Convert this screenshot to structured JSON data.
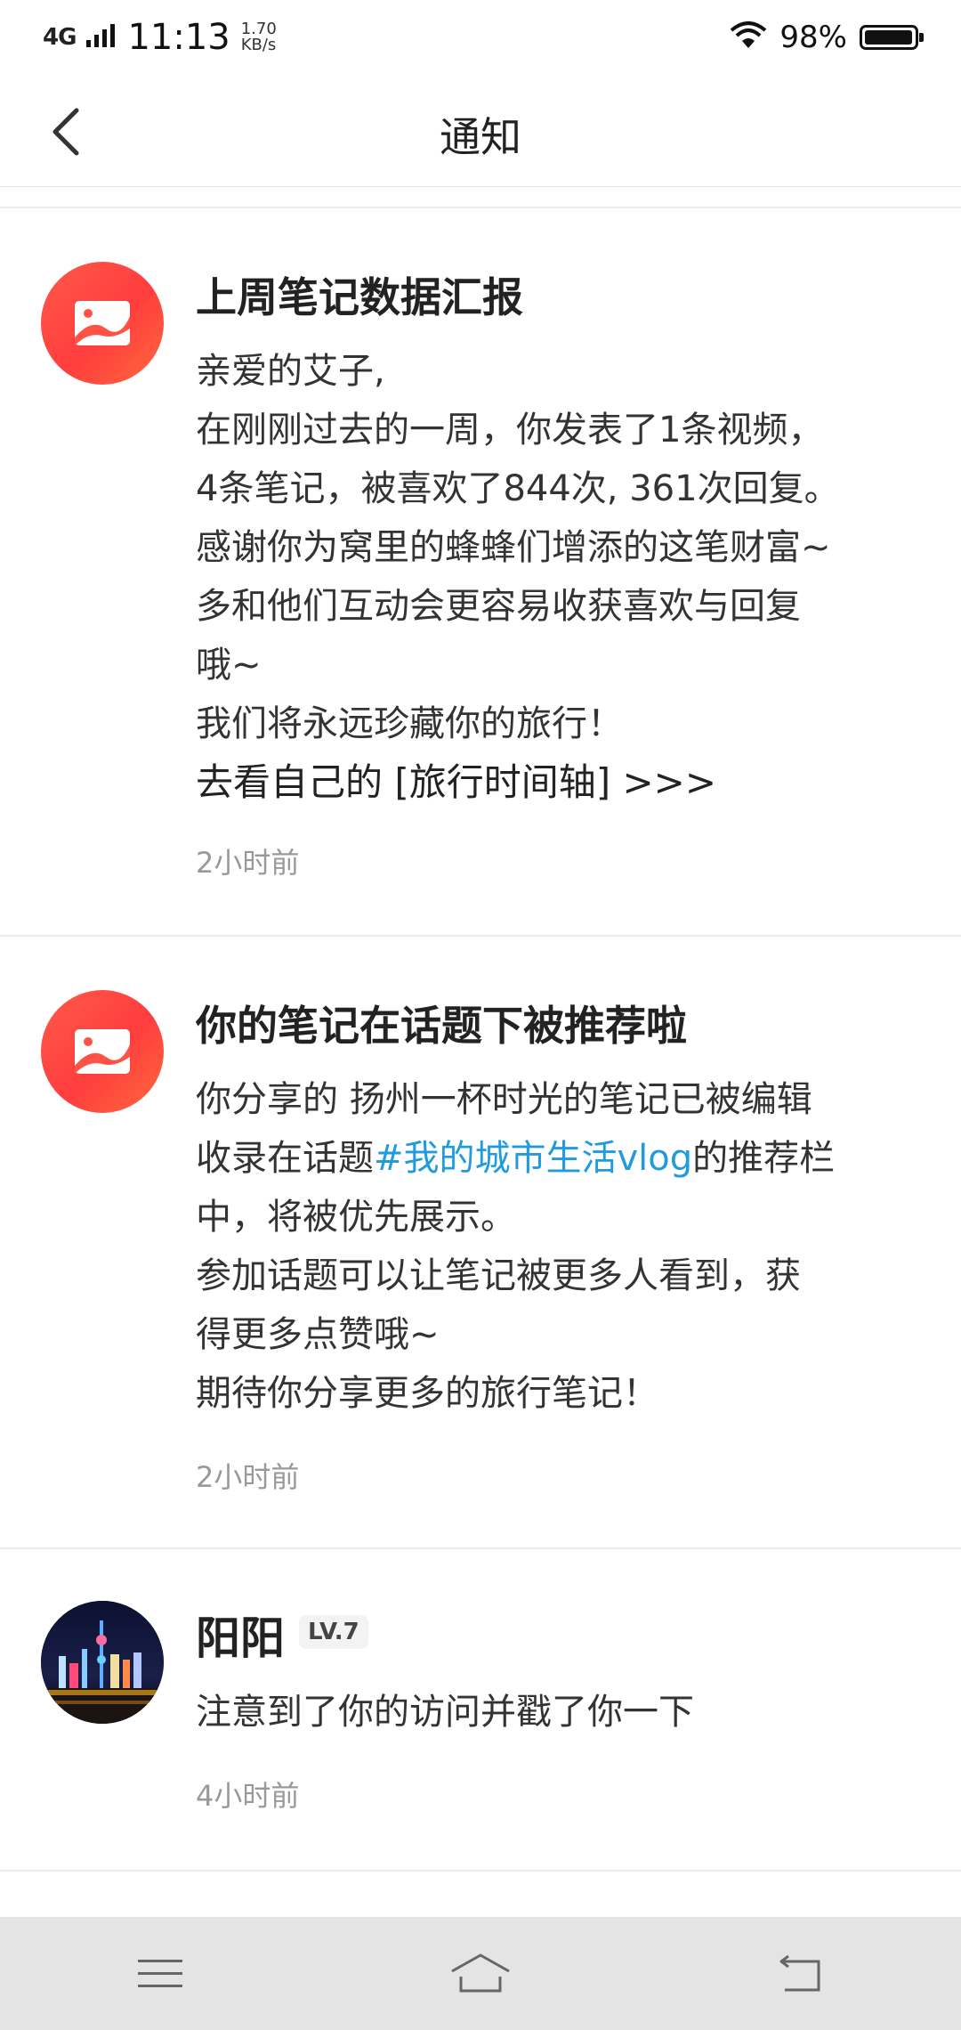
{
  "status_bar": {
    "network": "4G",
    "time": "11:13",
    "speed_value": "1.70",
    "speed_unit": "KB/s",
    "battery": "98%"
  },
  "nav": {
    "title": "通知"
  },
  "notifications": [
    {
      "type": "system",
      "title": "上周笔记数据汇报",
      "lines": [
        "亲爱的艾子,",
        "在刚刚过去的一周，你发表了1条视频，",
        "4条笔记，被喜欢了844次, 361次回复。",
        "感谢你为窝里的蜂蜂们增添的这笔财富~",
        "多和他们互动会更容易收获喜欢与回复",
        "哦~",
        "我们将永远珍藏你的旅行！"
      ],
      "link": "去看自己的 [旅行时间轴] >>>",
      "time": "2小时前"
    },
    {
      "type": "system",
      "title": "你的笔记在话题下被推荐啦",
      "line1": "你分享的 扬州一杯时光的笔记已被编辑",
      "line2_pre": "收录在话题",
      "topic": "#我的城市生活vlog",
      "line2_post": "的推荐栏",
      "line3": "中，将被优先展示。",
      "line4": "参加话题可以让笔记被更多人看到，获",
      "line5": "得更多点赞哦~",
      "line6": "期待你分享更多的旅行笔记！",
      "time": "2小时前"
    },
    {
      "type": "user",
      "name": "阳阳",
      "level": "LV.7",
      "message": "注意到了你的访问并戳了你一下",
      "time": "4小时前"
    }
  ],
  "system_nav": {
    "menu_icon": "menu-icon",
    "home_icon": "home-icon",
    "back_icon": "back-icon"
  }
}
